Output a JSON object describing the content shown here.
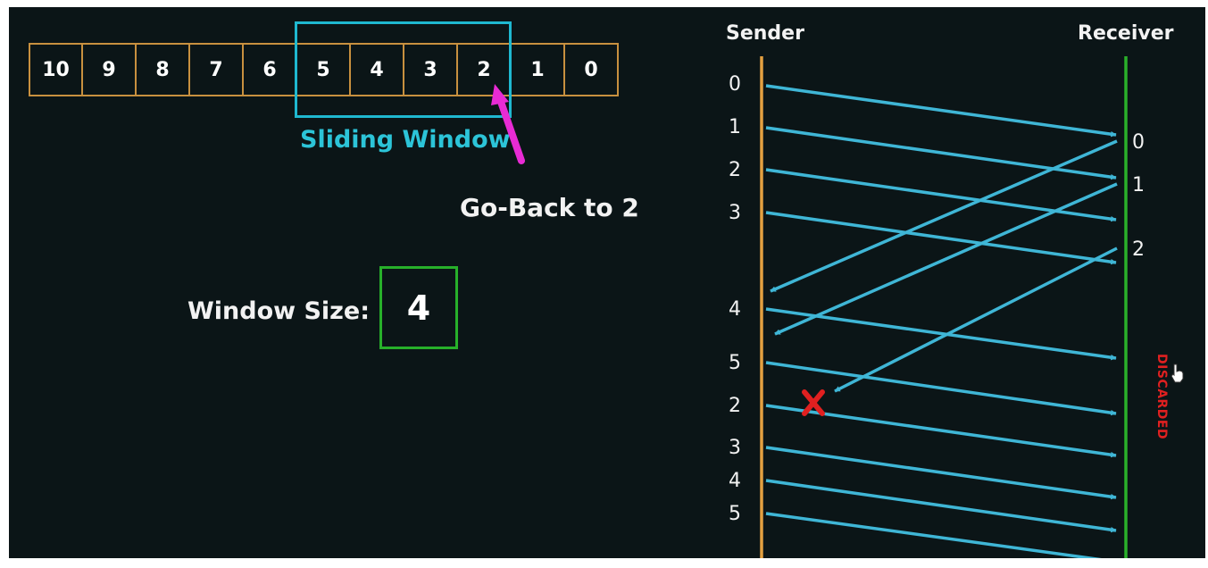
{
  "frames": [
    {
      "label": "10"
    },
    {
      "label": "9"
    },
    {
      "label": "8"
    },
    {
      "label": "7"
    },
    {
      "label": "6"
    },
    {
      "label": "5"
    },
    {
      "label": "4"
    },
    {
      "label": "3"
    },
    {
      "label": "2"
    },
    {
      "label": "1"
    },
    {
      "label": "0"
    }
  ],
  "sliding_window_label": "Sliding Window",
  "go_back_label": "Go-Back to 2",
  "window_size": {
    "label": "Window Size:",
    "value": "4"
  },
  "sender_label": "Sender",
  "receiver_label": "Receiver",
  "sender_seq": [
    "0",
    "1",
    "2",
    "3",
    "4",
    "5",
    "2",
    "3",
    "4",
    "5"
  ],
  "receiver_seq": [
    "0",
    "1",
    "2"
  ],
  "discarded_label": "DISCARDED",
  "colors": {
    "background": "#0b1517",
    "frame_border": "#c8903f",
    "window": "#1fb8d0",
    "arrow": "#3fb6d6",
    "sender_line": "#e3a040",
    "receiver_line": "#2ab02a",
    "pointer": "#e82bd4",
    "error": "#e02020"
  },
  "icons": [
    "pointer-arrow-icon",
    "lost-frame-x-icon",
    "cursor-hand-icon"
  ]
}
